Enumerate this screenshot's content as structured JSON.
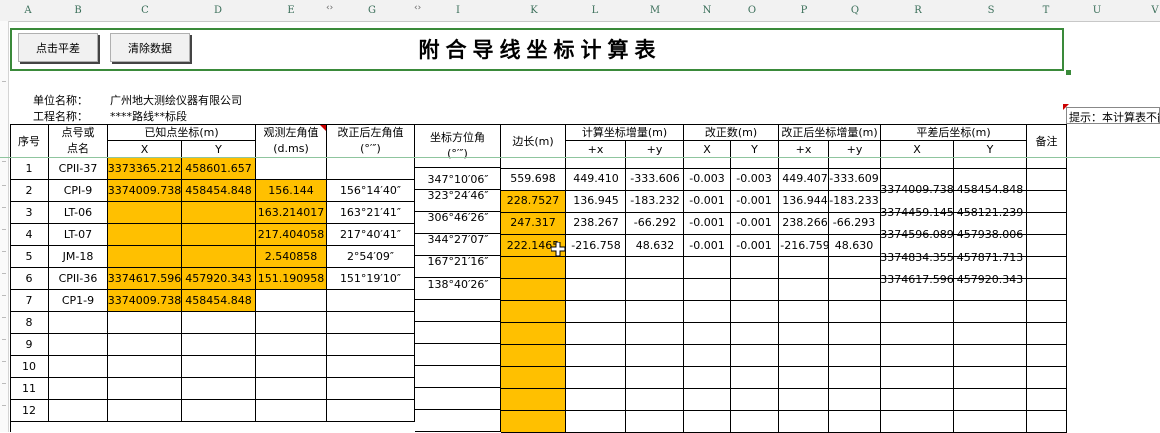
{
  "columns": [
    "A",
    "B",
    "C",
    "D",
    "E",
    "G",
    "I",
    "K",
    "L",
    "M",
    "N",
    "O",
    "P",
    "Q",
    "R",
    "S",
    "T",
    "U",
    "V"
  ],
  "toolbar": {
    "calc_label": "点击平差",
    "clear_label": "清除数据"
  },
  "title": "附合导线坐标计算表",
  "info": {
    "unit_label": "单位名称：",
    "unit_value": "广州地大测绘仪器有限公司",
    "project_label": "工程名称：",
    "project_value": "****路线**标段"
  },
  "comment": "提示：本计算表不能",
  "headers": {
    "seq": "序号",
    "point_a": "点号或",
    "point_b": "点名",
    "known": "已知点坐标(m)",
    "known_x": "X",
    "known_y": "Y",
    "obs_a": "观测左角值",
    "obs_b": "(d.ms)",
    "corr_a": "改正后左角值",
    "corr_b": "(°′″)",
    "az_a": "坐标方位角",
    "az_b": "(°′″)",
    "side": "边长(m)",
    "incr": "计算坐标增量(m)",
    "incr_x": "+x",
    "incr_y": "+y",
    "fix": "改正数(m)",
    "fix_x": "X",
    "fix_y": "Y",
    "adj": "改正后坐标增量(m)",
    "adj_x": "+x",
    "adj_y": "+y",
    "final": "平差后坐标(m)",
    "final_x": "X",
    "final_y": "Y",
    "note": "备注"
  },
  "rows": [
    {
      "no": "1",
      "name": "CPII-37",
      "kx": "3373365.212",
      "ky": "458601.657",
      "obs": "",
      "corr": ""
    },
    {
      "no": "2",
      "name": "CPI-9",
      "kx": "3374009.738",
      "ky": "458454.848",
      "obs": "156.144",
      "corr": "156°14′40″"
    },
    {
      "no": "3",
      "name": "LT-06",
      "kx": "",
      "ky": "",
      "obs": "163.214017",
      "corr": "163°21′41″"
    },
    {
      "no": "4",
      "name": "LT-07",
      "kx": "",
      "ky": "",
      "obs": "217.404058",
      "corr": "217°40′41″"
    },
    {
      "no": "5",
      "name": "JM-18",
      "kx": "",
      "ky": "",
      "obs": "2.540858",
      "corr": "2°54′09″"
    },
    {
      "no": "6",
      "name": "CPII-36",
      "kx": "3374617.596",
      "ky": "457920.343",
      "obs": "151.190958",
      "corr": "151°19′10″"
    },
    {
      "no": "7",
      "name": "CP1-9",
      "kx": "3374009.738",
      "ky": "458454.848",
      "obs": "",
      "corr": ""
    },
    {
      "no": "8",
      "name": "",
      "kx": "",
      "ky": "",
      "obs": "",
      "corr": ""
    },
    {
      "no": "9",
      "name": "",
      "kx": "",
      "ky": "",
      "obs": "",
      "corr": ""
    },
    {
      "no": "10",
      "name": "",
      "kx": "",
      "ky": "",
      "obs": "",
      "corr": ""
    },
    {
      "no": "11",
      "name": "",
      "kx": "",
      "ky": "",
      "obs": "",
      "corr": ""
    },
    {
      "no": "12",
      "name": "",
      "kx": "",
      "ky": "",
      "obs": "",
      "corr": ""
    }
  ],
  "azimuths": [
    "347°10′06″",
    "323°24′46″",
    "306°46′26″",
    "344°27′07″",
    "167°21′16″",
    "138°40′26″"
  ],
  "legs": [
    {
      "side": "559.698",
      "dx": "449.410",
      "dy": "-333.606",
      "vx": "-0.003",
      "vy": "-0.003",
      "ax": "449.407",
      "ay": "-333.609"
    },
    {
      "side": "228.7527",
      "dx": "136.945",
      "dy": "-183.232",
      "vx": "-0.001",
      "vy": "-0.001",
      "ax": "136.944",
      "ay": "-183.233"
    },
    {
      "side": "247.317",
      "dx": "238.267",
      "dy": "-66.292",
      "vx": "-0.001",
      "vy": "-0.001",
      "ax": "238.266",
      "ay": "-66.293"
    },
    {
      "side": "222.1465",
      "dx": "-216.758",
      "dy": "48.632",
      "vx": "-0.001",
      "vy": "-0.001",
      "ax": "-216.759",
      "ay": "48.630"
    }
  ],
  "final_coords": [
    {
      "x": "3374009.738",
      "y": "458454.848"
    },
    {
      "x": "3374459.145",
      "y": "458121.239"
    },
    {
      "x": "3374596.089",
      "y": "457938.006"
    },
    {
      "x": "3374834.355",
      "y": "457871.713"
    },
    {
      "x": "3374617.596",
      "y": "457920.343"
    }
  ],
  "colors": {
    "fill": "#ffc000",
    "frame": "#3a8a3a",
    "header_text": "#3b6f5a"
  }
}
